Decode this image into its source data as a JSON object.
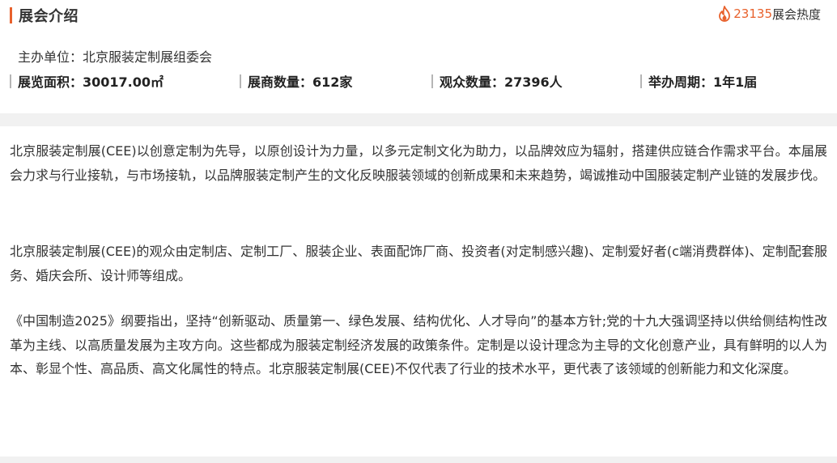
{
  "header": {
    "title": "展会介绍",
    "heat_count": "23135",
    "heat_label": "展会热度",
    "accent_color": "#e8612c"
  },
  "info": {
    "host": "主办单位：北京服装定制展组委会",
    "stats": [
      {
        "label": "展览面积：30017.00㎡"
      },
      {
        "label": "展商数量：612家"
      },
      {
        "label": "观众数量：27396人"
      },
      {
        "label": "举办周期：1年1届"
      }
    ]
  },
  "description": {
    "paragraphs": [
      "北京服装定制展(CEE)以创意定制为先导，以原创设计为力量，以多元定制文化为助力，以品牌效应为辐射，搭建供应链合作需求平台。本届展会力求与行业接轨，与市场接轨，以品牌服装定制产生的文化反映服装领域的创新成果和未来趋势，竭诚推动中国服装定制产业链的发展步伐。",
      "北京服装定制展(CEE)的观众由定制店、定制工厂、服装企业、表面配饰厂商、投资者(对定制感兴趣)、定制爱好者(c端消费群体)、定制配套服务、婚庆会所、设计师等组成。",
      "《中国制造2025》纲要指出，坚持“创新驱动、质量第一、绿色发展、结构优化、人才导向”的基本方针;党的十九大强调坚持以供给侧结构性改革为主线、以高质量发展为主攻方向。这些都成为服装定制经济发展的政策条件。定制是以设计理念为主导的文化创意产业，具有鲜明的以人为本、彰显个性、高品质、高文化属性的特点。北京服装定制展(CEE)不仅代表了行业的技术水平，更代表了该领域的创新能力和文化深度。"
    ]
  }
}
